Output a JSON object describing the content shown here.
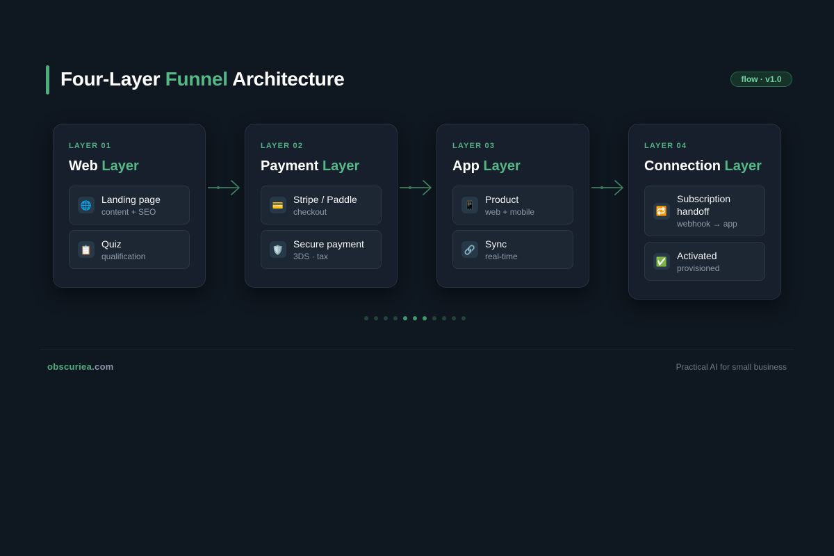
{
  "header": {
    "title_pre": "Four-Layer ",
    "title_accent": "Funnel",
    "title_post": " Architecture",
    "badge": "flow · v1.0"
  },
  "layers": [
    {
      "eyebrow": "LAYER 01",
      "title_main": "Web ",
      "title_accent": "Layer",
      "items": [
        {
          "icon": "globe-icon",
          "glyph": "🌐",
          "label": "Landing page",
          "sub": "content + SEO"
        },
        {
          "icon": "clipboard-icon",
          "glyph": "📋",
          "label": "Quiz",
          "sub": "qualification"
        }
      ]
    },
    {
      "eyebrow": "LAYER 02",
      "title_main": "Payment ",
      "title_accent": "Layer",
      "items": [
        {
          "icon": "credit-card-icon",
          "glyph": "💳",
          "label": "Stripe / Paddle",
          "sub": "checkout"
        },
        {
          "icon": "shield-icon",
          "glyph": "🛡️",
          "label": "Secure payment",
          "sub": "3DS · tax"
        }
      ]
    },
    {
      "eyebrow": "LAYER 03",
      "title_main": "App ",
      "title_accent": "Layer",
      "items": [
        {
          "icon": "mobile-phone-icon",
          "glyph": "📱",
          "label": "Product",
          "sub": "web + mobile"
        },
        {
          "icon": "link-icon",
          "glyph": "🔗",
          "label": "Sync",
          "sub": "real-time"
        }
      ]
    },
    {
      "eyebrow": "LAYER 04",
      "title_main": "Connection ",
      "title_accent": "Layer",
      "items": [
        {
          "icon": "repeat-icon",
          "glyph": "🔁",
          "label": "Subscription handoff",
          "sub": "webhook → app"
        },
        {
          "icon": "check-mark-icon",
          "glyph": "✅",
          "label": "Activated",
          "sub": "provisioned"
        }
      ]
    }
  ],
  "pager": {
    "total": 11,
    "active": [
      4,
      5,
      6
    ]
  },
  "footer": {
    "brand_name": "obscuriea",
    "brand_tld": ".com",
    "tagline": "Practical AI for small business"
  },
  "colors": {
    "accent": "#56b787",
    "background": "#0f1720",
    "card": "#161f2b"
  }
}
